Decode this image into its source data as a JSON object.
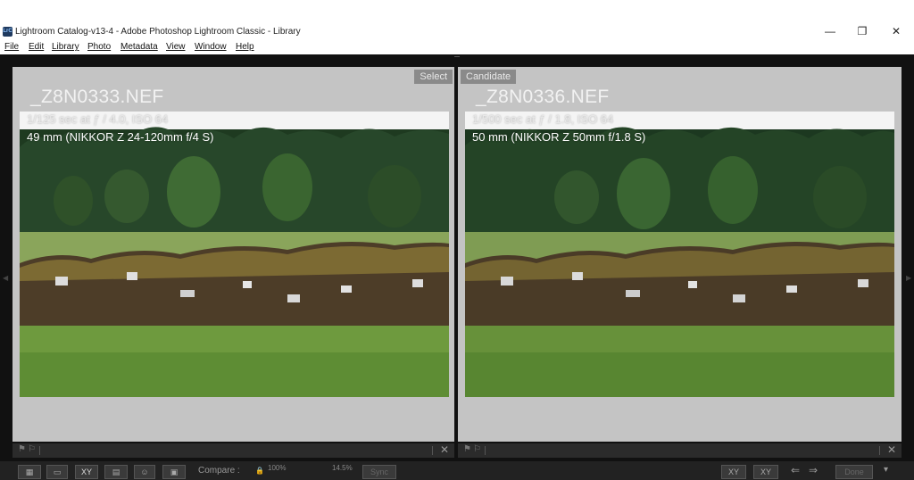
{
  "window": {
    "title": "Lightroom Catalog-v13-4 - Adobe Photoshop Lightroom Classic - Library",
    "app_icon_text": "LrC",
    "minimize": "—",
    "restore": "❐",
    "close": "✕"
  },
  "menu": [
    "File",
    "Edit",
    "Library",
    "Photo",
    "Metadata",
    "View",
    "Window",
    "Help"
  ],
  "select_panel": {
    "tag": "Select",
    "filename": "_Z8N0333.NEF",
    "exposure": "1/125 sec at ƒ / 4.0, ISO 64",
    "lens": "49 mm (NIKKOR Z 24-120mm f/4 S)"
  },
  "candidate_panel": {
    "tag": "Candidate",
    "filename": "_Z8N0336.NEF",
    "exposure": "1/500 sec at ƒ / 1.8, ISO 64",
    "lens": "50 mm (NIKKOR Z 50mm f/1.8 S)"
  },
  "toolbar": {
    "compare_label": "Compare :",
    "zoom_value": "100%",
    "zoom_value2": "14.5%",
    "sync_label": "Sync",
    "xy_label": "XY",
    "done_label": "Done"
  },
  "icons": {
    "flag": "flag-icon",
    "close": "close-icon",
    "grid": "grid-view-icon",
    "loupe": "loupe-view-icon",
    "compare": "compare-view-icon",
    "survey": "survey-view-icon",
    "people": "people-view-icon",
    "lock": "lock-icon",
    "swap": "swap-icon",
    "arrow_left": "arrow-left-icon",
    "arrow_right": "arrow-right-icon"
  }
}
